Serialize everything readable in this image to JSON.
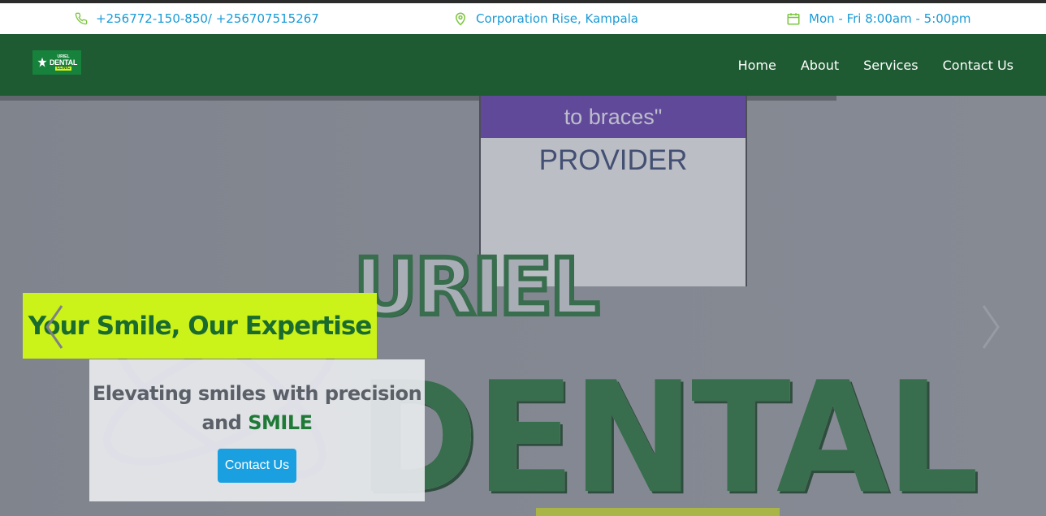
{
  "topbar": {
    "phone": "+256772-150-850/ +256707515267",
    "address": "Corporation Rise, Kampala",
    "hours": "Mon - Fri 8:00am - 5:00pm",
    "icons": [
      "phone-icon",
      "location-pin-icon",
      "calendar-icon"
    ]
  },
  "brand": {
    "logo_line1": "URIEL",
    "logo_line2": "DENTAL",
    "logo_line3": "CLINIC"
  },
  "nav": {
    "items": [
      {
        "label": "Home"
      },
      {
        "label": "About"
      },
      {
        "label": "Services"
      },
      {
        "label": "Contact Us"
      }
    ]
  },
  "hero": {
    "sign_top": "to braces\"",
    "sign_provider": "PROVIDER",
    "letters_uriel": "URIEL",
    "letters_dental": "DENTAL",
    "tagline": "Your Smile, Our Expertise",
    "subtitle_part1": "Elevating smiles with precision and",
    "subtitle_part2": "SMILE",
    "cta_label": "Contact Us"
  },
  "colors": {
    "nav_bg": "#1e5a32",
    "accent_blue": "#1a9bd7",
    "tagline_bg": "#cbf219",
    "brand_green": "#1a6b2e",
    "cta_bg": "#1aa0e0"
  }
}
